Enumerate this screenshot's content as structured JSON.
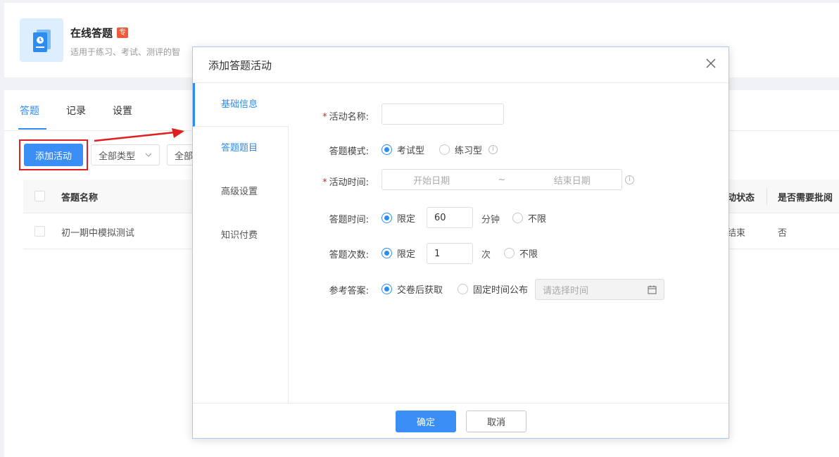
{
  "app": {
    "title": "在线答题",
    "badge": "专",
    "desc": "适用于练习、考试、测评的智"
  },
  "tabs": [
    {
      "label": "答题"
    },
    {
      "label": "记录"
    },
    {
      "label": "设置"
    }
  ],
  "toolbar": {
    "add_label": "添加活动",
    "type_select": "全部类型",
    "type_select2": "全部"
  },
  "table": {
    "headers": {
      "name": "答题名称",
      "status": "动状态",
      "review": "是否需要批阅"
    },
    "rows": [
      {
        "name": "初一期中模拟测试",
        "status": "结束",
        "review": "否"
      }
    ]
  },
  "modal": {
    "title": "添加答题活动",
    "nav": [
      {
        "label": "基础信息"
      },
      {
        "label": "答题题目"
      },
      {
        "label": "高级设置"
      },
      {
        "label": "知识付费"
      }
    ],
    "form": {
      "name_label": "活动名称:",
      "mode_label": "答题模式:",
      "mode_exam": "考试型",
      "mode_practice": "练习型",
      "time_label": "活动时间:",
      "start_placeholder": "开始日期",
      "range_sep": "~",
      "end_placeholder": "结束日期",
      "duration_label": "答题时间:",
      "duration_limited": "限定",
      "duration_value": "60",
      "duration_unit": "分钟",
      "duration_unlimited": "不限",
      "count_label": "答题次数:",
      "count_limited": "限定",
      "count_value": "1",
      "count_unit": "次",
      "count_unlimited": "不限",
      "answer_label": "参考答案:",
      "answer_after": "交卷后获取",
      "answer_fixed": "固定时间公布",
      "answer_time_placeholder": "请选择时间"
    },
    "ok_label": "确定",
    "cancel_label": "取消"
  }
}
